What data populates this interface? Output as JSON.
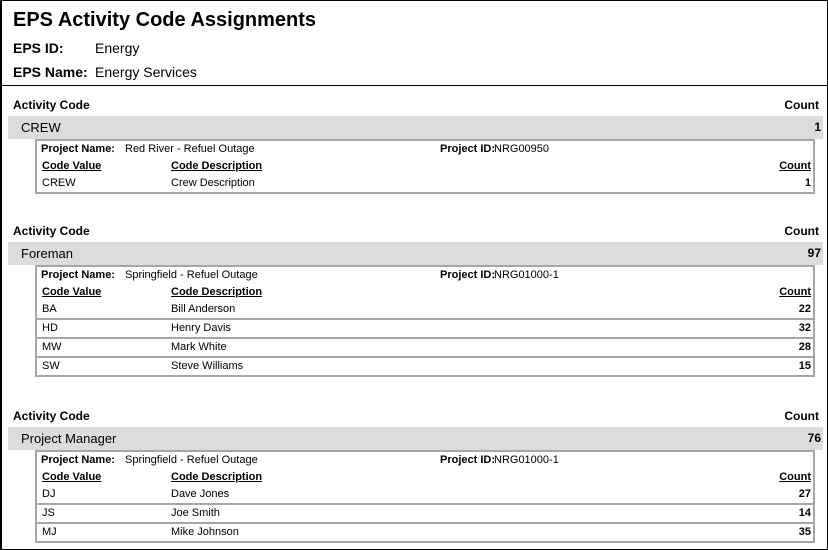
{
  "report": {
    "title": "EPS Activity Code Assignments",
    "eps_id_label": "EPS ID:",
    "eps_id": "Energy",
    "eps_name_label": "EPS Name:",
    "eps_name": "Energy Services"
  },
  "labels": {
    "activity_code": "Activity Code",
    "count": "Count",
    "project_name": "Project Name:",
    "project_id": "Project ID:",
    "code_value": "Code Value",
    "code_description": "Code Description"
  },
  "groups": [
    {
      "activity_code": "CREW",
      "count": "1",
      "project_name": "Red River - Refuel Outage",
      "project_id": "NRG00950",
      "rows": [
        {
          "code_value": "CREW",
          "code_description": "Crew Description",
          "count": "1"
        }
      ]
    },
    {
      "activity_code": "Foreman",
      "count": "97",
      "project_name": "Springfield - Refuel Outage",
      "project_id": "NRG01000-1",
      "rows": [
        {
          "code_value": "BA",
          "code_description": "Bill Anderson",
          "count": "22"
        },
        {
          "code_value": "HD",
          "code_description": "Henry Davis",
          "count": "32"
        },
        {
          "code_value": "MW",
          "code_description": "Mark White",
          "count": "28"
        },
        {
          "code_value": "SW",
          "code_description": "Steve Williams",
          "count": "15"
        }
      ]
    },
    {
      "activity_code": "Project Manager",
      "count": "76",
      "project_name": "Springfield - Refuel Outage",
      "project_id": "NRG01000-1",
      "rows": [
        {
          "code_value": "DJ",
          "code_description": "Dave Jones",
          "count": "27"
        },
        {
          "code_value": "JS",
          "code_description": "Joe Smith",
          "count": "14"
        },
        {
          "code_value": "MJ",
          "code_description": "Mike Johnson",
          "count": "35"
        }
      ]
    }
  ]
}
